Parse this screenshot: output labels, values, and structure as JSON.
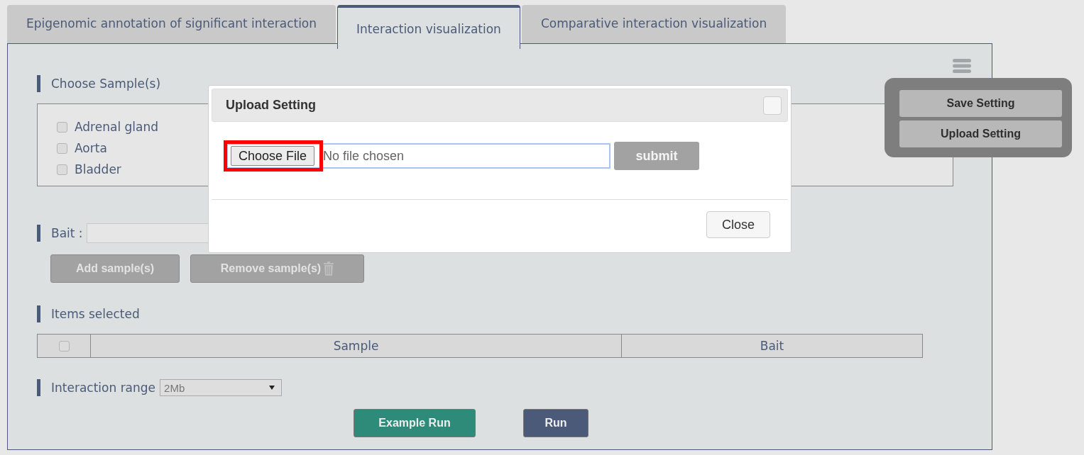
{
  "tabs": [
    {
      "label": "Epigenomic annotation of significant interaction",
      "selected": false
    },
    {
      "label": "Interaction visualization",
      "selected": true
    },
    {
      "label": "Comparative interaction visualization",
      "selected": false
    }
  ],
  "samples": {
    "heading": "Choose Sample(s)",
    "items": [
      {
        "label": "Adrenal gland",
        "checked": false
      },
      {
        "label": "Aorta",
        "checked": false
      },
      {
        "label": "Bladder",
        "checked": false
      }
    ]
  },
  "bait": {
    "label": "Bait :",
    "add_button": "Add sample(s)",
    "remove_button": "Remove sample(s)"
  },
  "items_selected": {
    "heading": "Items selected",
    "select_all_checked": false,
    "columns": [
      "Sample",
      "Bait"
    ]
  },
  "interaction_range": {
    "label": "Interaction range",
    "value": "2Mb"
  },
  "run_buttons": [
    "Example Run",
    "Run"
  ],
  "settings_menu": {
    "items": [
      "Save Setting",
      "Upload Setting"
    ]
  },
  "modal": {
    "title": "Upload Setting",
    "choose_file": {
      "label": "Choose File",
      "highlighted": true
    },
    "file_status": "No file chosen",
    "submit": "submit",
    "close": "Close"
  }
}
